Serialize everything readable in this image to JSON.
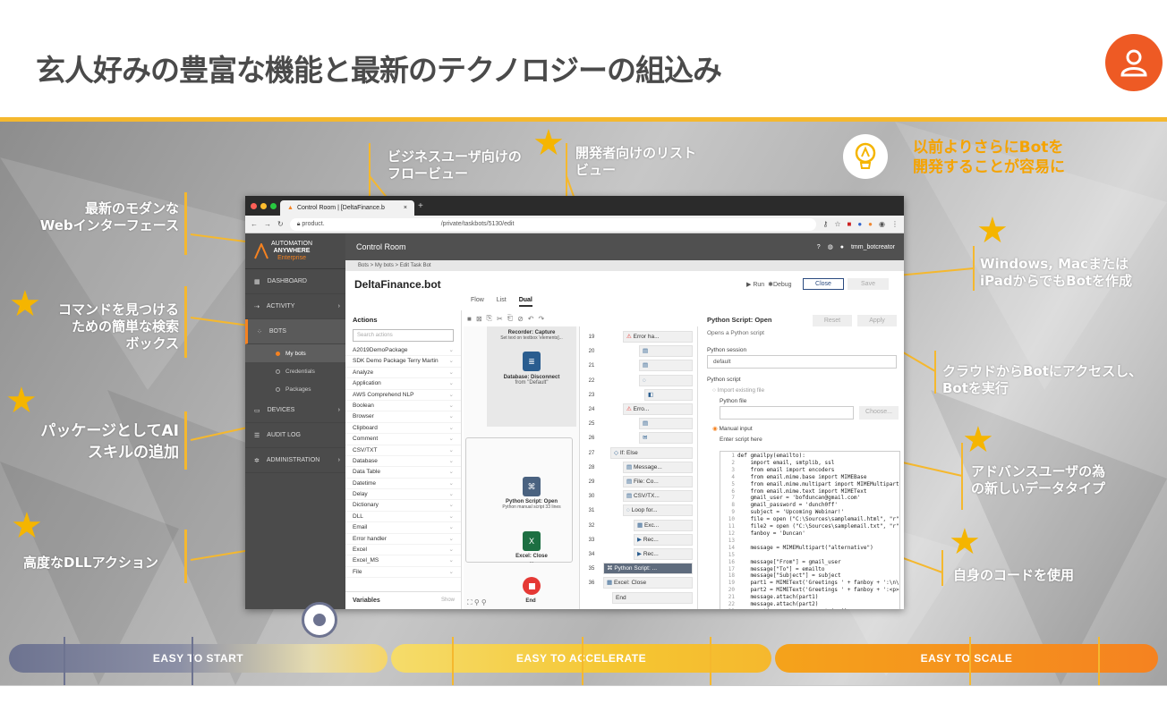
{
  "title": "玄人好みの豊富な機能と最新のテクノロジーの組込み",
  "colors": {
    "accent": "#f5b82e",
    "user_badge": "#ee5a24",
    "timeline_start": "#6d7390",
    "timeline_mid": "#f5c632",
    "timeline_end": "#f58220"
  },
  "callouts": {
    "web_ui": [
      "最新のモダンな",
      "Webインターフェース"
    ],
    "search": [
      "コマンドを見つける",
      "ための簡単な検索",
      "ボックス"
    ],
    "ai_pkg": [
      "パッケージとしてAI",
      "スキルの追加"
    ],
    "dll": "高度なDLLアクション",
    "flow_view": [
      "ビジネスユーザ向けの",
      "フロービュー"
    ],
    "list_view": [
      "開発者向けのリスト",
      "ビュー"
    ],
    "easier": [
      "以前よりさらにBotを",
      "開発することが容易に"
    ],
    "platform": [
      "Windows, Macまたは",
      "iPadからでもBotを作成"
    ],
    "cloud": [
      "クラウドからBotにアクセスし、",
      "Botを実行"
    ],
    "datatypes": [
      "アドバンスユーザの為",
      "の新しいデータタイプ"
    ],
    "own_code": "自身のコードを使用"
  },
  "timeline": [
    "EASY TO START",
    "EASY TO ACCELERATE",
    "EASY TO SCALE"
  ],
  "browser": {
    "tab_title": "Control Room | [DeltaFinance.b",
    "url_left": "product.",
    "url_right": "/private/taskbots/5130/edit"
  },
  "app": {
    "logo_line1": "AUTOMATION",
    "logo_line2": "ANYWHERE",
    "logo_line3": "Enterprise",
    "header": "Control Room",
    "user": "tmm_botcreator",
    "nav": [
      "DASHBOARD",
      "ACTIVITY",
      "BOTS",
      "DEVICES",
      "AUDIT LOG",
      "ADMINISTRATION"
    ],
    "bots_sub": [
      "My bots",
      "Credentials",
      "Packages"
    ],
    "breadcrumb": "Bots  >  My bots  >  Edit Task Bot",
    "bot_name": "DeltaFinance.bot",
    "run": "▶ Run",
    "debug": "Debug",
    "close": "Close",
    "save": "Save",
    "view_tabs": [
      "Flow",
      "List",
      "Dual"
    ],
    "actions_title": "Actions",
    "search_placeholder": "Search actions",
    "actions": [
      "A2019DemoPackage",
      "SDK Demo Package Terry Martin",
      "Analyze",
      "Application",
      "AWS Comprehend NLP",
      "Boolean",
      "Browser",
      "Clipboard",
      "Comment",
      "CSV/TXT",
      "Database",
      "Data Table",
      "Datetime",
      "Delay",
      "Dictionary",
      "DLL",
      "Email",
      "Error handler",
      "Excel",
      "Excel_MS",
      "File"
    ],
    "variables": "Variables",
    "show": "Show",
    "flow": {
      "recorder_title": "Recorder: Capture",
      "recorder_sub": "Set text on textbox 'elements]...",
      "db_title": "Database: Disconnect",
      "db_sub": "from \"Default\"",
      "py_title": "Python Script: Open",
      "py_sub": "Python manual script 33 lines",
      "xl_title": "Excel: Close",
      "xl_sub": "...",
      "end": "End"
    },
    "list_rows": [
      {
        "n": "19",
        "t": "Error ha..."
      },
      {
        "n": "20",
        "t": ""
      },
      {
        "n": "21",
        "t": ""
      },
      {
        "n": "22",
        "t": ""
      },
      {
        "n": "23",
        "t": ""
      },
      {
        "n": "24",
        "t": "Erro..."
      },
      {
        "n": "25",
        "t": ""
      },
      {
        "n": "26",
        "t": ""
      },
      {
        "n": "27",
        "t": "If: Else"
      },
      {
        "n": "28",
        "t": "Message..."
      },
      {
        "n": "29",
        "t": "File: Co..."
      },
      {
        "n": "30",
        "t": "CSV/TX..."
      },
      {
        "n": "31",
        "t": "Loop for..."
      },
      {
        "n": "32",
        "t": "Exc..."
      },
      {
        "n": "33",
        "t": "Rec..."
      },
      {
        "n": "34",
        "t": "Rec..."
      },
      {
        "n": "35",
        "t": "Python Script: ..."
      },
      {
        "n": "36",
        "t": "Excel: Close"
      },
      {
        "n": "",
        "t": "End"
      }
    ],
    "py_panel": {
      "title": "Python Script: Open",
      "reset": "Reset",
      "apply": "Apply",
      "desc": "Opens a Python script",
      "session_label": "Python session",
      "session_value": "default",
      "script_label": "Python script",
      "import_label": "Import existing file",
      "file_label": "Python file",
      "choose": "Choose...",
      "manual_label": "Manual input",
      "enter_label": "Enter script here"
    },
    "code": [
      "def gmailpy(emailto):",
      "    import email, smtplib, ssl",
      "    from email import encoders",
      "    from email.mime.base import MIMEBase",
      "    from email.mime.multipart import MIMEMultipart",
      "    from email.mime.text import MIMEText",
      "    gmail_user = 'bofduncan@gmail.com'",
      "    gmail_password = 'dunch0ff'",
      "    subject = 'Upcoming Webinar!'",
      "    file = open (\"C:\\Sources\\samplemail.html\", \"r\")",
      "    file2 = open (\"C:\\Sources\\samplemail.txt\", \"r\")",
      "    fanboy = 'Duncan'",
      "",
      "    message = MIMEMultipart(\"alternative\")",
      "",
      "    message[\"From\"] = gmail_user",
      "    message[\"To\"] = emailto",
      "    message[\"Subject\"] = subject",
      "    part1 = MIMEText('Greetings ' + fanboy + ':\\n\\n'",
      "    part2 = MIMEText('Greetings ' + fanboy + ':<p>'",
      "    message.attach(part1)",
      "    message.attach(part2)",
      "    greeting = message.as_string()",
      "",
      "    server = smtplib.SMTP_SSL('smtp.gmail.com', 465)",
      "    server.ehlo()",
      "    server.login(gmail_user, gmail_password)"
    ]
  }
}
